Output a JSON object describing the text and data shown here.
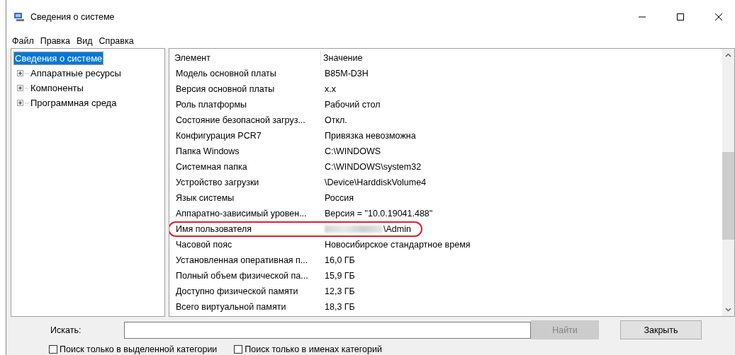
{
  "window": {
    "title": "Сведения о системе"
  },
  "menu": [
    "Файл",
    "Правка",
    "Вид",
    "Справка"
  ],
  "tree": {
    "items": [
      {
        "label": "Сведения о системе",
        "selected": true,
        "children": [
          {
            "label": "Аппаратные ресурсы",
            "selected": false,
            "expanded": false
          },
          {
            "label": "Компоненты",
            "selected": false,
            "expanded": false
          },
          {
            "label": "Программная среда",
            "selected": false,
            "expanded": false
          }
        ]
      }
    ]
  },
  "table": {
    "columns": [
      "Элемент",
      "Значение"
    ],
    "rows": [
      {
        "name": "Модель основной платы",
        "value": "B85M-D3H",
        "redacted": false,
        "circled": false
      },
      {
        "name": "Версия основной платы",
        "value": "x.x",
        "redacted": false,
        "circled": false
      },
      {
        "name": "Роль платформы",
        "value": "Рабочий стол",
        "redacted": false,
        "circled": false
      },
      {
        "name": "Состояние безопасной загруз...",
        "value": "Откл.",
        "redacted": false,
        "circled": false
      },
      {
        "name": "Конфигурация PCR7",
        "value": "Привязка невозможна",
        "redacted": false,
        "circled": false
      },
      {
        "name": "Папка Windows",
        "value": "C:\\WINDOWS",
        "redacted": false,
        "circled": false
      },
      {
        "name": "Системная папка",
        "value": "C:\\WINDOWS\\system32",
        "redacted": false,
        "circled": false
      },
      {
        "name": "Устройство загрузки",
        "value": "\\Device\\HarddiskVolume4",
        "redacted": false,
        "circled": false
      },
      {
        "name": "Язык системы",
        "value": "Россия",
        "redacted": false,
        "circled": false
      },
      {
        "name": "Аппаратно-зависимый уровен...",
        "value": "Версия = \"10.0.19041.488\"",
        "redacted": false,
        "circled": false
      },
      {
        "name": "Имя пользователя",
        "value": "\\Admin",
        "redacted": true,
        "circled": true
      },
      {
        "name": "Часовой пояс",
        "value": "Новосибирское стандартное время",
        "redacted": false,
        "circled": false
      },
      {
        "name": "Установленная оперативная п...",
        "value": "16,0 ГБ",
        "redacted": false,
        "circled": false
      },
      {
        "name": "Полный объем физической па...",
        "value": "15,9 ГБ",
        "redacted": false,
        "circled": false
      },
      {
        "name": "Доступно физической памяти",
        "value": "12,3 ГБ",
        "redacted": false,
        "circled": false
      },
      {
        "name": "Всего виртуальной памяти",
        "value": "18,3 ГБ",
        "redacted": false,
        "circled": false
      }
    ]
  },
  "search": {
    "label": "Искать:"
  },
  "buttons": [
    {
      "label": "Найти",
      "disabled": true
    },
    {
      "label": "Закрыть",
      "disabled": false
    }
  ],
  "options": [
    {
      "label": "Поиск только в выделенной категории",
      "checked": false
    },
    {
      "label": "Поиск только в именах категорий",
      "checked": false
    }
  ]
}
